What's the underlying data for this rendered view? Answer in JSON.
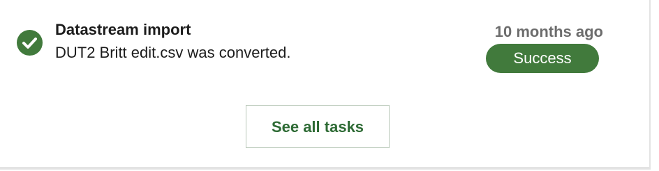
{
  "task": {
    "icon": "check-circle-icon",
    "title": "Datastream import",
    "message": "DUT2 Britt edit.csv was converted.",
    "time": "10 months ago",
    "status": "Success"
  },
  "actions": {
    "see_all_label": "See all tasks"
  },
  "colors": {
    "success_green": "#417a3c",
    "button_text": "#2e6b35",
    "muted_text": "#6d6d6d"
  }
}
